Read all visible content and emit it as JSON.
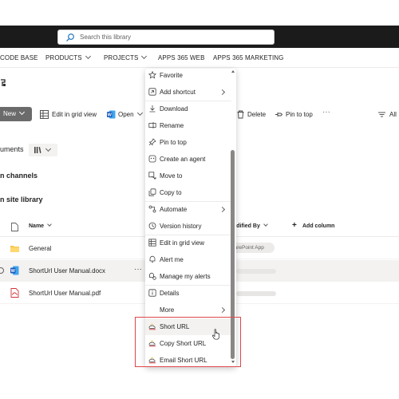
{
  "search": {
    "placeholder": "Search this library"
  },
  "nav": {
    "items": [
      "CODE BASE",
      "PRODUCTS",
      "PROJECTS",
      "APPS 365 WEB",
      "APPS 365 MARKETING"
    ]
  },
  "commandbar": {
    "new_label": "New",
    "grid_label": "Edit in grid view",
    "open_label": "Open",
    "delete_label": "Delete",
    "pin_label": "Pin to top",
    "all_label": "All"
  },
  "library": {
    "title": "uments",
    "sections": [
      "n channels",
      "n site library"
    ]
  },
  "columns": {
    "name": "Name",
    "modified_by": "odified By",
    "add_column": "Add column"
  },
  "rows": [
    {
      "name": "General"
    },
    {
      "name": "ShortUrl User Manual.docx"
    },
    {
      "name": "ShortUrl User Manual.pdf"
    }
  ],
  "pill_text": "harePoint App",
  "context_menu": {
    "items": [
      {
        "label": "Favorite",
        "icon": "star-icon"
      },
      {
        "label": "Add shortcut",
        "icon": "shortcut-icon"
      },
      {
        "label": "Download",
        "icon": "download-icon"
      },
      {
        "label": "Rename",
        "icon": "rename-icon"
      },
      {
        "label": "Pin to top",
        "icon": "pin-icon"
      },
      {
        "label": "Create an agent",
        "icon": "agent-icon"
      },
      {
        "label": "Move to",
        "icon": "move-icon"
      },
      {
        "label": "Copy to",
        "icon": "copy-icon"
      },
      {
        "label": "Automate",
        "icon": "automate-icon"
      },
      {
        "label": "Version history",
        "icon": "history-icon"
      },
      {
        "label": "Edit in grid view",
        "icon": "grid-icon"
      },
      {
        "label": "Alert me",
        "icon": "bell-icon"
      },
      {
        "label": "Manage my alerts",
        "icon": "alerts-icon"
      },
      {
        "label": "Details",
        "icon": "info-icon"
      },
      {
        "label": "More",
        "icon": "none"
      },
      {
        "label": "Short URL",
        "icon": "link-cloud-icon"
      },
      {
        "label": "Copy Short URL",
        "icon": "link-cloud-icon"
      },
      {
        "label": "Email Short URL",
        "icon": "link-cloud-icon"
      }
    ]
  },
  "colors": {
    "suite_bar": "#1b1b1b",
    "new_button": "#6b6b6b",
    "highlight_box": "#e0474c",
    "word_blue": "#185abd",
    "pdf_red": "#d13438",
    "folder_yellow": "#f4c44e"
  }
}
